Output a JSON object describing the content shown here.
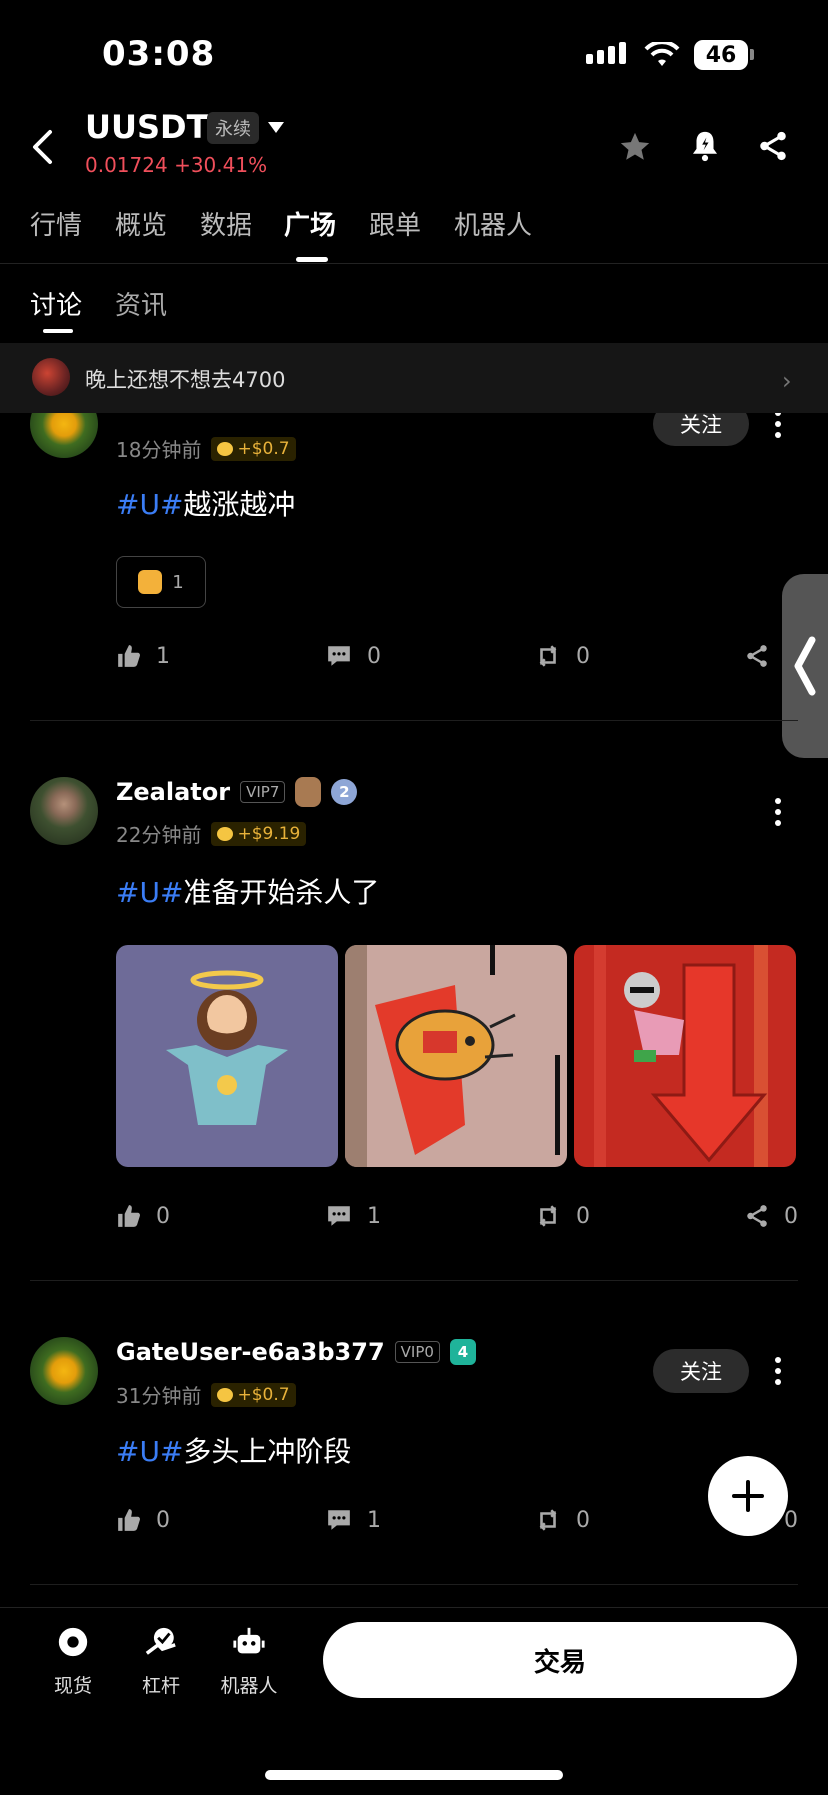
{
  "status_bar": {
    "time": "03:08",
    "battery": "46"
  },
  "header": {
    "symbol": "UUSDT",
    "contract_type": "永续",
    "price": "0.01724",
    "change": "+30.41%"
  },
  "main_tabs": [
    {
      "label": "行情"
    },
    {
      "label": "概览"
    },
    {
      "label": "数据"
    },
    {
      "label": "广场"
    },
    {
      "label": "跟单"
    },
    {
      "label": "机器人"
    }
  ],
  "sub_tabs": [
    {
      "label": "讨论"
    },
    {
      "label": "资讯"
    }
  ],
  "banner": {
    "text": "晚上还想不想去4700"
  },
  "posts": [
    {
      "time": "18分钟前",
      "tip": "+$0.7",
      "follow": "关注",
      "hashtag": "#U#",
      "text": "越涨越冲",
      "reaction_count": "1",
      "likes": "1",
      "comments": "0",
      "reposts": "0"
    },
    {
      "username": "Zealator",
      "vip": "VIP7",
      "level": "2",
      "time": "22分钟前",
      "tip": "+$9.19",
      "hashtag": "#U#",
      "text": "准备开始杀人了",
      "likes": "0",
      "comments": "1",
      "reposts": "0",
      "shares": "0"
    },
    {
      "username": "GateUser-e6a3b377",
      "vip": "VIP0",
      "level": "4",
      "time": "31分钟前",
      "tip": "+$0.7",
      "follow": "关注",
      "hashtag": "#U#",
      "text": "多头上冲阶段",
      "likes": "0",
      "comments": "1",
      "reposts": "0",
      "shares": "0"
    }
  ],
  "bottom_nav": [
    {
      "label": "现货"
    },
    {
      "label": "杠杆"
    },
    {
      "label": "机器人"
    }
  ],
  "trade_button": "交易",
  "colors": {
    "price_red": "#f04f5b",
    "hashtag_blue": "#3b7df5",
    "tip_gold": "#e8b23a",
    "badge_teal": "#1fb39a"
  }
}
